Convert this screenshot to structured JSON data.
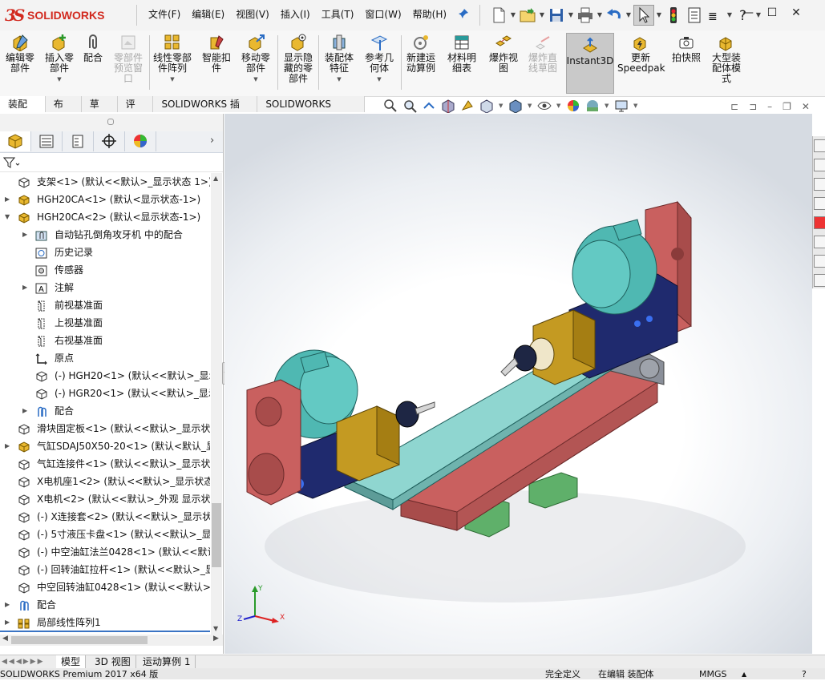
{
  "app": {
    "logo_text": "SOLIDWORKS",
    "menu": [
      "文件(F)",
      "编辑(E)",
      "视图(V)",
      "插入(I)",
      "工具(T)",
      "窗口(W)",
      "帮助(H)"
    ]
  },
  "ribbon": [
    {
      "label": "编辑零\n部件",
      "dropdown": false,
      "disabled": false
    },
    {
      "label": "插入零\n部件",
      "dropdown": true,
      "disabled": false
    },
    {
      "label": "配合",
      "dropdown": false,
      "disabled": false
    },
    {
      "label": "零部件\n预览窗\n口",
      "dropdown": false,
      "disabled": true
    },
    {
      "label": "线性零部\n件阵列",
      "dropdown": true,
      "disabled": false
    },
    {
      "label": "智能扣\n件",
      "dropdown": false,
      "disabled": false
    },
    {
      "label": "移动零\n部件",
      "dropdown": true,
      "disabled": false
    },
    {
      "label": "显示隐\n藏的零\n部件",
      "dropdown": false,
      "disabled": false
    },
    {
      "label": "装配体\n特征",
      "dropdown": true,
      "disabled": false
    },
    {
      "label": "参考几\n何体",
      "dropdown": true,
      "disabled": false
    },
    {
      "label": "新建运\n动算例",
      "dropdown": false,
      "disabled": false
    },
    {
      "label": "材料明\n细表",
      "dropdown": false,
      "disabled": false
    },
    {
      "label": "爆炸视\n图",
      "dropdown": false,
      "disabled": false
    },
    {
      "label": "爆炸直\n线草图",
      "dropdown": false,
      "disabled": true
    },
    {
      "label": "Instant3D",
      "dropdown": false,
      "disabled": false
    },
    {
      "label": "更新\nSpeedpak",
      "dropdown": false,
      "disabled": false
    },
    {
      "label": "拍快照",
      "dropdown": false,
      "disabled": false
    },
    {
      "label": "大型装\n配体模\n式",
      "dropdown": false,
      "disabled": false
    }
  ],
  "tabs": [
    "装配体",
    "布局",
    "草图",
    "评估",
    "SOLIDWORKS 插件",
    "SOLIDWORKS MBD"
  ],
  "tree": [
    {
      "label": "支架<1> (默认<<默认>_显示状态 1>)",
      "indent": 0,
      "expander": false,
      "icon": "part-icon"
    },
    {
      "label": "HGH20CA<1> (默认<显示状态-1>)",
      "indent": 0,
      "expander": true,
      "icon": "subassembly-icon"
    },
    {
      "label": "HGH20CA<2> (默认<显示状态-1>)",
      "indent": 0,
      "expander": true,
      "open": true,
      "icon": "subassembly-icon"
    },
    {
      "label": "自动钻孔倒角攻牙机 中的配合",
      "indent": 1,
      "expander": true,
      "icon": "mates-folder-icon"
    },
    {
      "label": "历史记录",
      "indent": 1,
      "expander": false,
      "icon": "history-icon"
    },
    {
      "label": "传感器",
      "indent": 1,
      "expander": false,
      "icon": "sensor-icon"
    },
    {
      "label": "注解",
      "indent": 1,
      "expander": true,
      "icon": "annotation-icon"
    },
    {
      "label": "前视基准面",
      "indent": 1,
      "expander": false,
      "icon": "plane-icon"
    },
    {
      "label": "上视基准面",
      "indent": 1,
      "expander": false,
      "icon": "plane-icon"
    },
    {
      "label": "右视基准面",
      "indent": 1,
      "expander": false,
      "icon": "plane-icon"
    },
    {
      "label": "原点",
      "indent": 1,
      "expander": false,
      "icon": "origin-icon"
    },
    {
      "label": "(-) HGH20<1> (默认<<默认>_显示",
      "indent": 1,
      "expander": false,
      "icon": "part-icon"
    },
    {
      "label": "(-) HGR20<1> (默认<<默认>_显示",
      "indent": 1,
      "expander": false,
      "icon": "part-icon"
    },
    {
      "label": "配合",
      "indent": 1,
      "expander": true,
      "icon": "mates-icon"
    },
    {
      "label": "滑块固定板<1> (默认<<默认>_显示状态",
      "indent": 0,
      "expander": false,
      "icon": "part-icon"
    },
    {
      "label": "气缸SDAJ50X50-20<1> (默认<默认_显",
      "indent": 0,
      "expander": true,
      "icon": "subassembly-icon"
    },
    {
      "label": "气缸连接件<1> (默认<<默认>_显示状态",
      "indent": 0,
      "expander": false,
      "icon": "part-icon"
    },
    {
      "label": "X电机座1<2> (默认<<默认>_显示状态",
      "indent": 0,
      "expander": false,
      "icon": "part-icon"
    },
    {
      "label": "X电机<2> (默认<<默认>_外观 显示状态",
      "indent": 0,
      "expander": false,
      "icon": "part-icon"
    },
    {
      "label": "(-) X连接套<2> (默认<<默认>_显示状态",
      "indent": 0,
      "expander": false,
      "icon": "part-icon"
    },
    {
      "label": "(-) 5寸液压卡盘<1> (默认<<默认>_显示",
      "indent": 0,
      "expander": false,
      "icon": "part-icon"
    },
    {
      "label": "(-) 中空油缸法兰0428<1> (默认<<默认",
      "indent": 0,
      "expander": false,
      "icon": "part-icon"
    },
    {
      "label": "(-) 回转油缸拉杆<1> (默认<<默认>_显示",
      "indent": 0,
      "expander": false,
      "icon": "part-icon"
    },
    {
      "label": "中空回转油缸0428<1> (默认<<默认>_显",
      "indent": 0,
      "expander": false,
      "icon": "part-icon"
    },
    {
      "label": "配合",
      "indent": 0,
      "expander": true,
      "icon": "mates-icon"
    },
    {
      "label": "局部线性阵列1",
      "indent": 0,
      "expander": true,
      "icon": "linear-pattern-icon"
    }
  ],
  "doc_tabs": [
    "模型",
    "3D 视图",
    "运动算例 1"
  ],
  "status": {
    "product": "SOLIDWORKS Premium 2017 x64 版",
    "definition": "完全定义",
    "editing": "在编辑 装配体",
    "units": "MMGS"
  },
  "triad": {
    "y": "Y",
    "x": "X",
    "z": "Z"
  },
  "colors": {
    "motor_teal": "#4fb8b2",
    "bracket_red": "#c9605f",
    "plate_cyan": "#8fd6d0",
    "gearbox_gold": "#c49a22",
    "motor_navy": "#1f2a6e",
    "base_green": "#5fb06a"
  }
}
